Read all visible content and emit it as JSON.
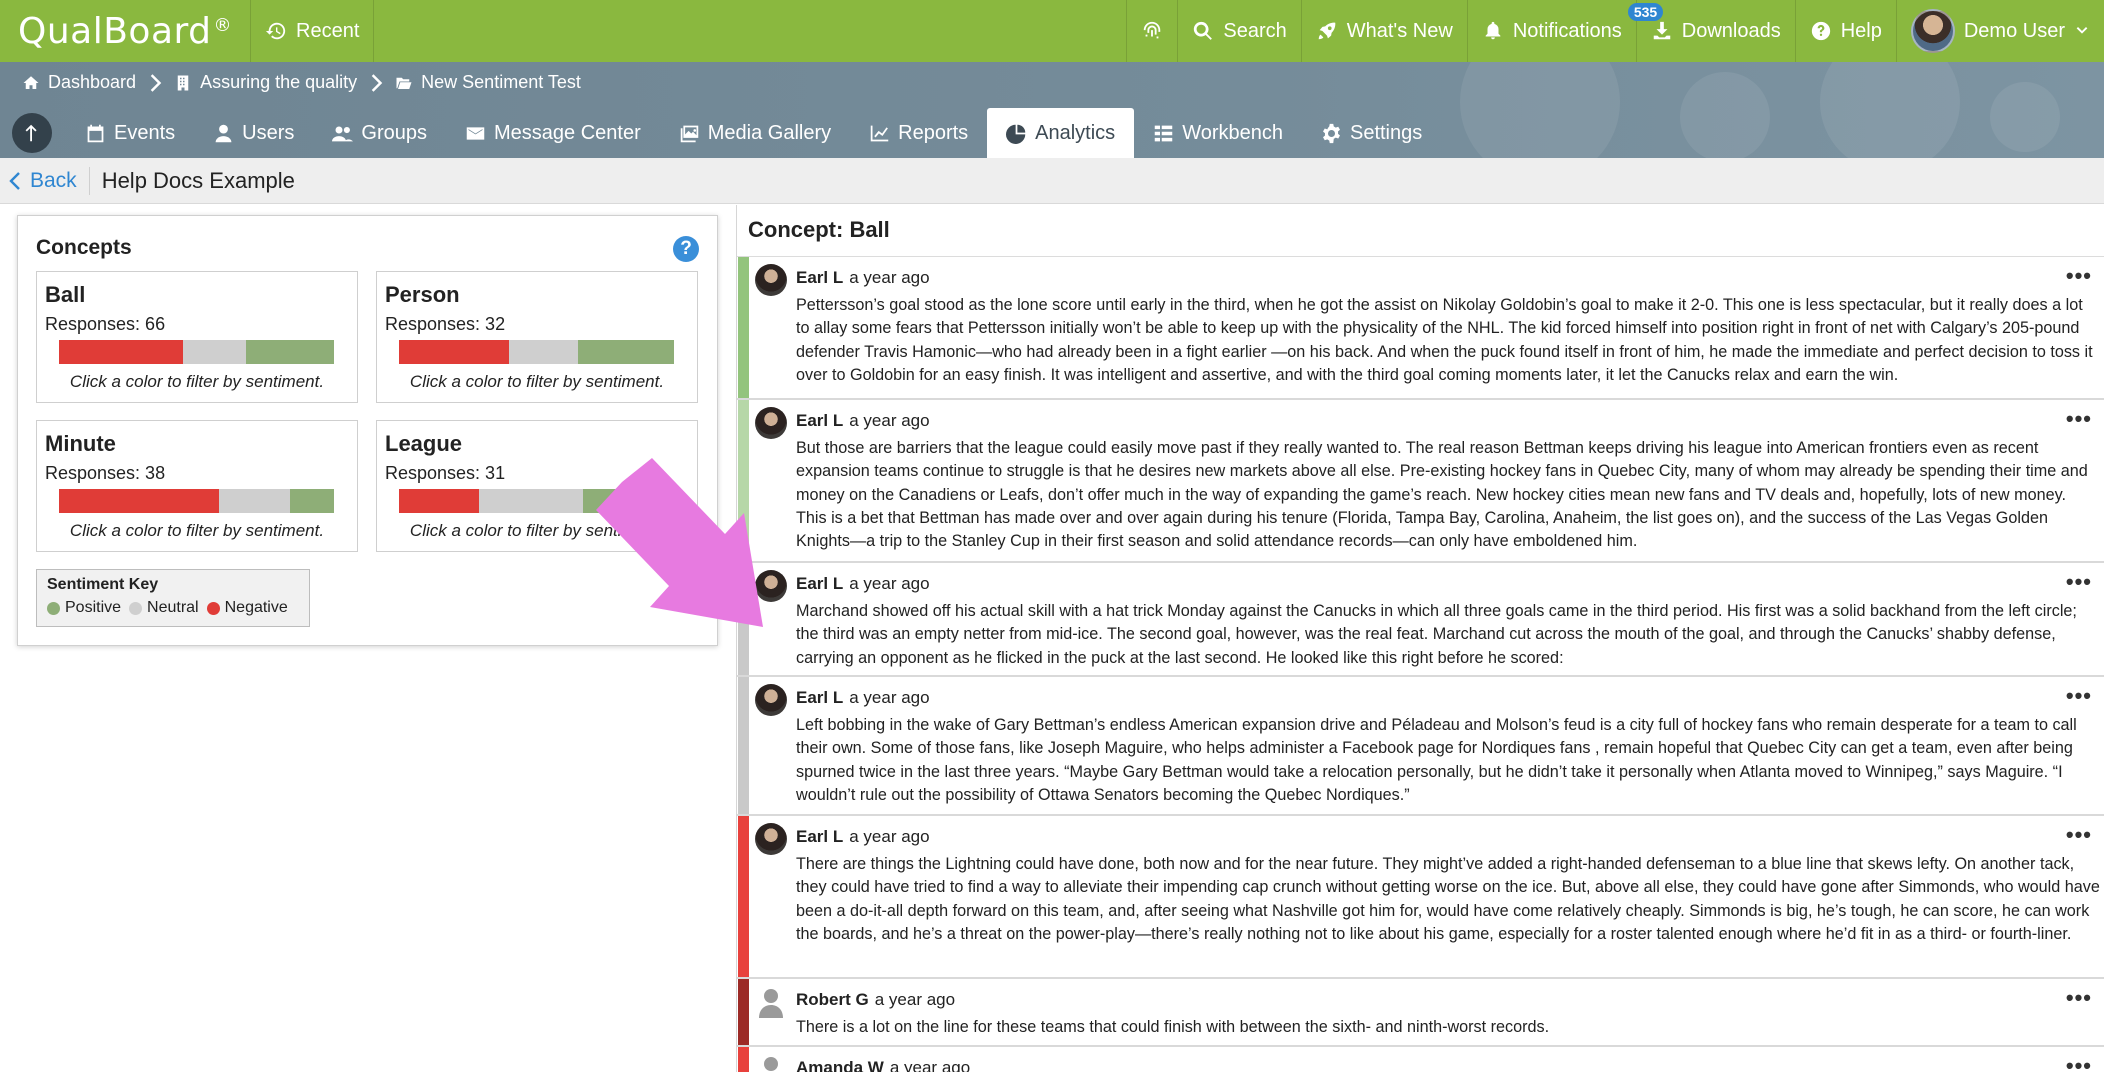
{
  "topbar": {
    "logo": "QualBoard",
    "logo_mark": "®",
    "recent": "Recent",
    "search": "Search",
    "whats_new": "What's New",
    "notifications": "Notifications",
    "notifications_count": "535",
    "downloads": "Downloads",
    "help": "Help",
    "user": "Demo User"
  },
  "breadcrumb": [
    "Dashboard",
    "Assuring the quality",
    "New Sentiment Test"
  ],
  "nav": {
    "tabs": [
      "Events",
      "Users",
      "Groups",
      "Message Center",
      "Media Gallery",
      "Reports",
      "Analytics",
      "Workbench",
      "Settings"
    ],
    "active": "Analytics"
  },
  "subheader": {
    "back": "Back",
    "title": "Help Docs Example"
  },
  "concepts": {
    "title": "Concepts",
    "hint": "Click a color to filter by sentiment.",
    "items": [
      {
        "name": "Ball",
        "responses": "Responses: 66",
        "negative": 0.45,
        "neutral": 0.23,
        "positive": 0.32
      },
      {
        "name": "Person",
        "responses": "Responses: 32",
        "negative": 0.4,
        "neutral": 0.25,
        "positive": 0.35
      },
      {
        "name": "Minute",
        "responses": "Responses: 38",
        "negative": 0.58,
        "neutral": 0.26,
        "positive": 0.16
      },
      {
        "name": "League",
        "responses": "Responses: 31",
        "negative": 0.29,
        "neutral": 0.38,
        "positive": 0.33
      }
    ]
  },
  "sentiment_key": {
    "title": "Sentiment Key",
    "positive": "Positive",
    "neutral": "Neutral",
    "negative": "Negative",
    "colors": {
      "positive": "#8eae77",
      "neutral": "#cfcfcf",
      "negative": "#e03c37"
    }
  },
  "concept_panel": {
    "title": "Concept: Ball",
    "more": "•••",
    "responses": [
      {
        "author": "Earl L",
        "time": "a year ago",
        "sentiment": "positive",
        "strip_color": "#93c47d",
        "text": "Pettersson’s goal stood as the lone score until early in the third, when he got the assist on Nikolay Goldobin’s goal to make it 2-0. This one is less spectacular, but it really does a lot to allay some fears that Pettersson initially won’t be able to keep up with the physicality of the NHL. The kid forced himself into position right in front of net with Calgary’s 205-pound defender Travis Hamonic—who had already been in a fight earlier —on his back. And when the puck found itself in front of him, he made the immediate and perfect decision to toss it over to Goldobin for an easy finish. It was intelligent and assertive, and with the third goal coming moments later, it let the Canucks relax and earn the win."
      },
      {
        "author": "Earl L",
        "time": "a year ago",
        "sentiment": "positive",
        "strip_color": "#b6d7a8",
        "text": "But those are barriers that the league could easily move past if they really wanted to. The real reason Bettman keeps driving his league into American frontiers even as recent expansion teams continue to struggle is that he desires new markets above all else. Pre-existing hockey fans in Quebec City, many of whom may already be spending their time and money on the Canadiens or Leafs, don’t offer much in the way of expanding the game’s reach. New hockey cities mean new fans and TV deals and, hopefully, lots of new money. This is a bet that Bettman has made over and over again during his tenure (Florida, Tampa Bay, Carolina, Anaheim, the list goes on), and the success of the Las Vegas Golden Knights—a trip to the Stanley Cup in their first season and solid attendance records—can only have emboldened him."
      },
      {
        "author": "Earl L",
        "time": "a year ago",
        "sentiment": "neutral",
        "strip_color": "#c9c9c9",
        "text": "Marchand showed off his actual skill with a hat trick Monday against the Canucks in which all three goals came in the third period. His first was a solid backhand from the left circle; the third was an empty netter from mid-ice. The second goal, however, was the real feat. Marchand cut across the mouth of the goal, and through the Canucks’ shabby defense, carrying an opponent as he flicked in the puck at the last second. He looked like this right before he scored:"
      },
      {
        "author": "Earl L",
        "time": "a year ago",
        "sentiment": "neutral",
        "strip_color": "#c9c9c9",
        "text": "Left bobbing in the wake of Gary Bettman’s endless American expansion drive and Péladeau and Molson’s feud is a city full of hockey fans who remain desperate for a team to call their own. Some of those fans, like Joseph Maguire, who helps administer a Facebook page for Nordiques fans , remain hopeful that Quebec City can get a team, even after being spurned twice in the last three years. “Maybe Gary Bettman would take a relocation personally, but he didn’t take it personally when Atlanta moved to Winnipeg,” says Maguire. “I wouldn’t rule out the possibility of Ottawa Senators becoming the Quebec Nordiques.”"
      },
      {
        "author": "Earl L",
        "time": "a year ago",
        "sentiment": "negative",
        "strip_color": "#e8413c",
        "text": "There are things the Lightning could have done, both now and for the near future. They might’ve added a right-handed defenseman to a blue line that skews lefty. On another tack, they could have tried to find a way to alleviate their impending cap crunch without getting worse on the ice. But, above all else, they could have gone after Simmonds, who would have been a do-it-all depth forward on this team, and, after seeing what Nashville got him for, would have come relatively cheaply. Simmonds is big, he’s tough, he can score, he can work the boards, and he’s a threat on the power-play—there’s really nothing not to like about his game, especially for a roster talented enough where he’d fit in as a third- or fourth-liner."
      },
      {
        "author": "Robert G",
        "time": "a year ago",
        "sentiment": "negative",
        "strip_color": "#9c2a26",
        "text": "There is a lot on the line for these teams that could finish with between the sixth- and ninth-worst records."
      },
      {
        "author": "Amanda W",
        "time": "a year ago",
        "sentiment": "negative",
        "strip_color": "#e8413c",
        "text": ""
      }
    ]
  }
}
